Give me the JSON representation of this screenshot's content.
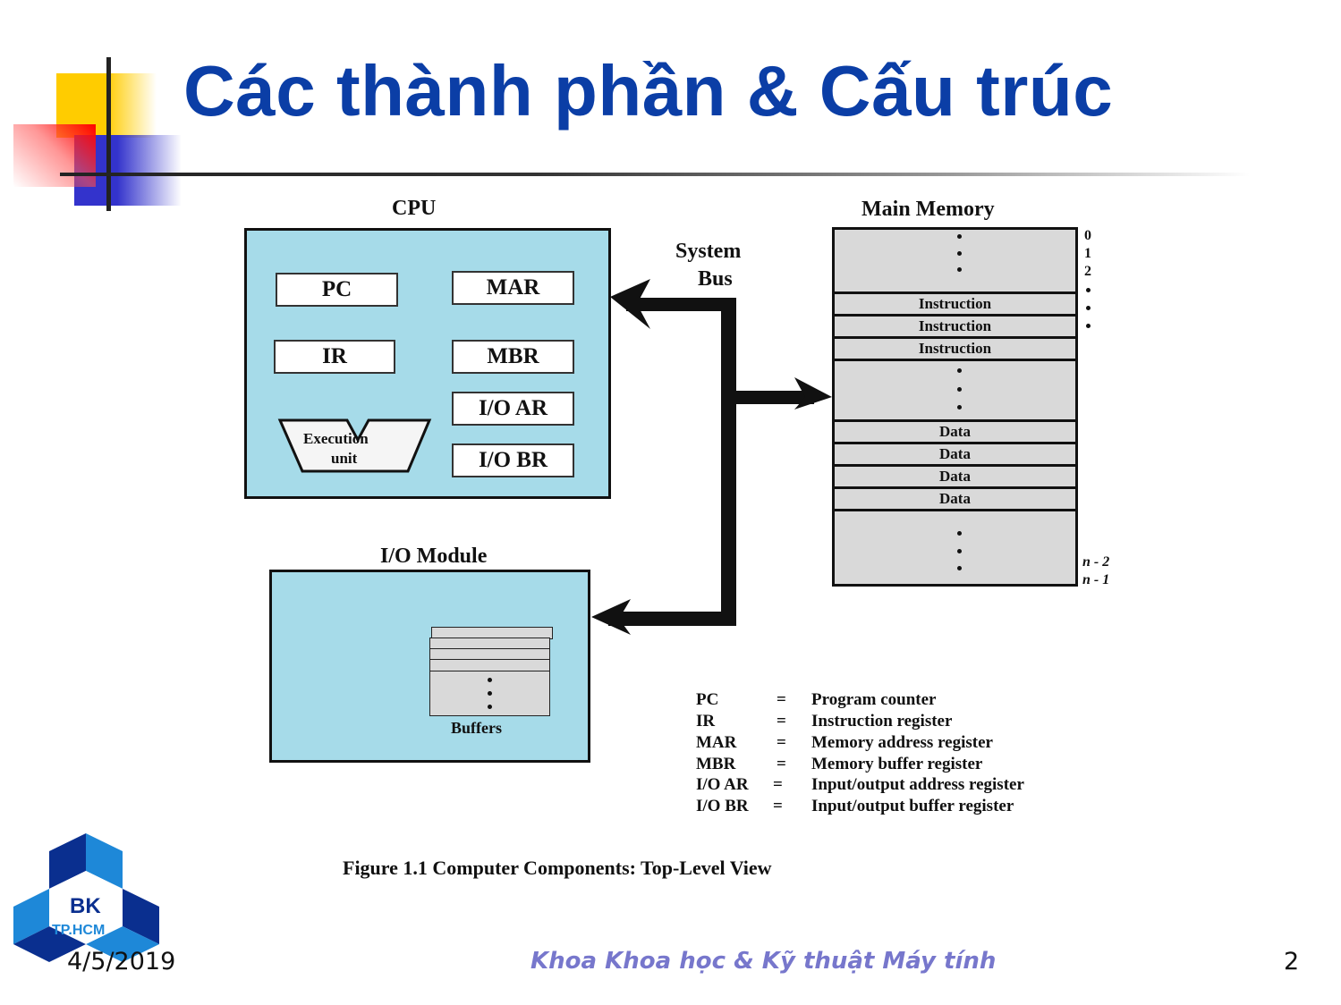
{
  "slide": {
    "title": "Các thành phần & Cấu trúc",
    "footer": {
      "date": "4/5/2019",
      "department": "Khoa Khoa học & Kỹ thuật Máy tính",
      "page_number": "2"
    },
    "logo": {
      "line1": "BK",
      "line2": "TP.HCM"
    },
    "colors": {
      "title": "#0b3ea6",
      "footer_text": "#7777cc",
      "module_fill": "#a6dbe9",
      "memory_fill": "#d9d9d9",
      "logo_dark": "#0a2f8f",
      "logo_light": "#1e88d8"
    }
  },
  "diagram": {
    "cpu": {
      "label": "CPU",
      "registers": [
        "PC",
        "MAR",
        "IR",
        "MBR",
        "I/O AR",
        "I/O BR"
      ],
      "execution_unit": {
        "line1": "Execution",
        "line2": "unit"
      }
    },
    "bus": {
      "line1": "System",
      "line2": "Bus"
    },
    "io_module": {
      "label": "I/O Module",
      "buffers_label": "Buffers"
    },
    "main_memory": {
      "label": "Main Memory",
      "rows": [
        "Instruction",
        "Instruction",
        "Instruction",
        "Data",
        "Data",
        "Data",
        "Data"
      ],
      "top_addresses": [
        "0",
        "1",
        "2"
      ],
      "bottom_addresses": [
        "n - 2",
        "n - 1"
      ]
    },
    "legend": [
      {
        "abbr": "PC",
        "eq": "=",
        "meaning": "Program counter"
      },
      {
        "abbr": "IR",
        "eq": "=",
        "meaning": "Instruction register"
      },
      {
        "abbr": "MAR",
        "eq": "=",
        "meaning": "Memory address register"
      },
      {
        "abbr": "MBR",
        "eq": "=",
        "meaning": "Memory buffer register"
      },
      {
        "abbr": "I/O AR",
        "eq": "=",
        "meaning": "Input/output address register"
      },
      {
        "abbr": "I/O BR",
        "eq": "=",
        "meaning": "Input/output buffer register"
      }
    ],
    "caption": "Figure 1.1  Computer Components: Top-Level View"
  }
}
